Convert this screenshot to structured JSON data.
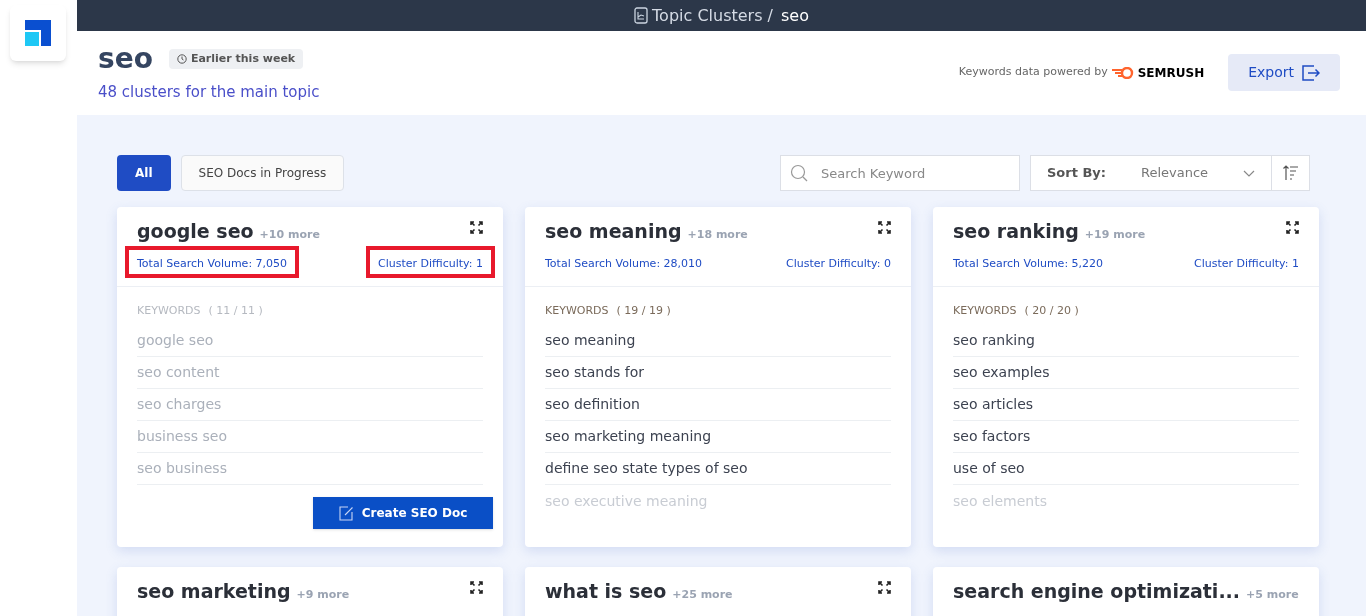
{
  "breadcrumb": {
    "section": "Topic Clusters /",
    "current": "seo"
  },
  "header": {
    "title": "seo",
    "badge": "Earlier this week",
    "subtitle": "48 clusters for the main topic",
    "powered_by": "Keywords data powered by",
    "provider": "SEMRUSH",
    "export": "Export"
  },
  "filters": [
    {
      "label": "All",
      "selected": true
    },
    {
      "label": "SEO Docs in Progress",
      "selected": false
    }
  ],
  "search": {
    "placeholder": "Search Keyword"
  },
  "sort": {
    "label": "Sort By:",
    "value": "Relevance"
  },
  "clusters": [
    {
      "title": "google seo",
      "more": "+10 more",
      "volume": "Total Search Volume: 7,050",
      "difficulty": "Cluster Difficulty: 1",
      "highlighted": true,
      "keywords_label": "KEYWORDS",
      "keywords_count": "( 11 / 11 )",
      "keywords": [
        "google seo",
        "seo content",
        "seo charges",
        "business seo",
        "seo business"
      ],
      "hovered": true,
      "action": "Create SEO Doc"
    },
    {
      "title": "seo meaning",
      "more": "+18 more",
      "volume": "Total Search Volume: 28,010",
      "difficulty": "Cluster Difficulty: 0",
      "highlighted": false,
      "keywords_label": "KEYWORDS",
      "keywords_count": "( 19 / 19 )",
      "keywords": [
        "seo meaning",
        "seo stands for",
        "seo definition",
        "seo marketing meaning",
        "define seo state types of seo",
        "seo executive meaning"
      ],
      "hovered": false
    },
    {
      "title": "seo ranking",
      "more": "+19 more",
      "volume": "Total Search Volume: 5,220",
      "difficulty": "Cluster Difficulty: 1",
      "highlighted": false,
      "keywords_label": "KEYWORDS",
      "keywords_count": "( 20 / 20 )",
      "keywords": [
        "seo ranking",
        "seo examples",
        "seo articles",
        "seo factors",
        "use of seo",
        "seo elements"
      ],
      "hovered": false
    },
    {
      "title": "seo marketing",
      "more": "+9 more"
    },
    {
      "title": "what is seo",
      "more": "+25 more"
    },
    {
      "title": "search engine optimizati...",
      "more": "+5 more"
    }
  ]
}
